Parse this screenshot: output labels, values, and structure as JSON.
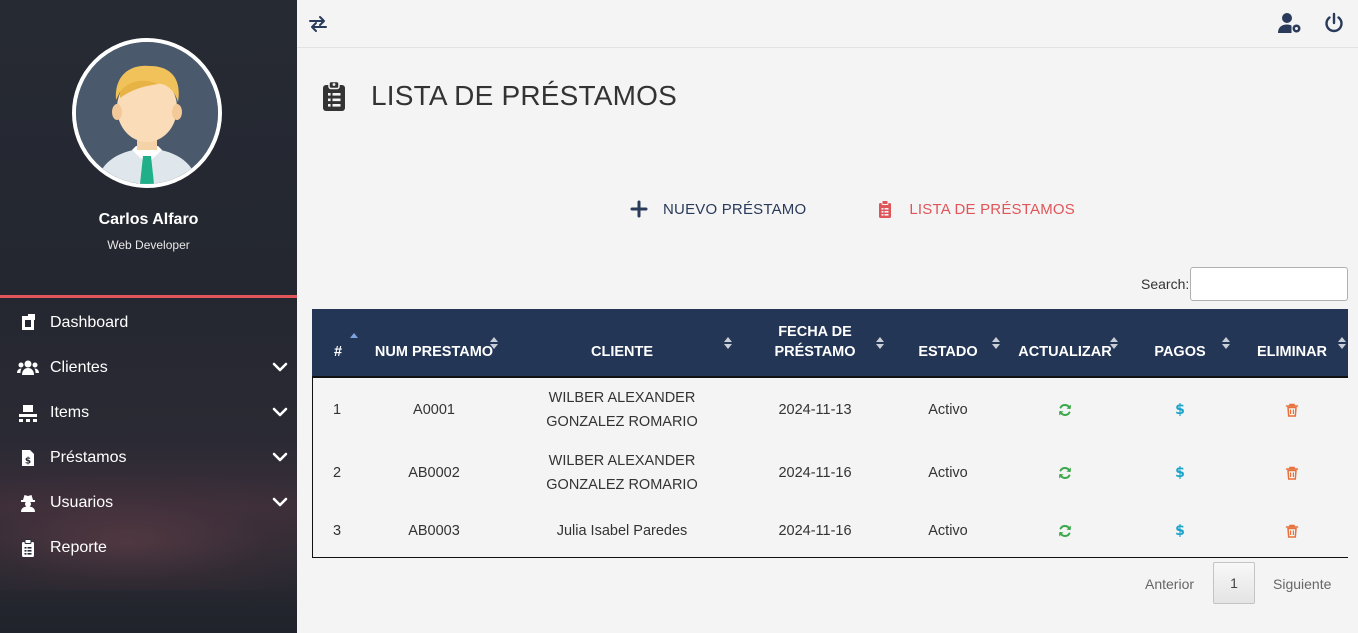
{
  "user": {
    "name": "Carlos Alfaro",
    "role": "Web Developer"
  },
  "sidebar": {
    "items": [
      {
        "label": "Dashboard",
        "icon": "dashboard-icon",
        "expandable": false
      },
      {
        "label": "Clientes",
        "icon": "users-icon",
        "expandable": true
      },
      {
        "label": "Items",
        "icon": "pallet-icon",
        "expandable": true
      },
      {
        "label": "Préstamos",
        "icon": "file-invoice-dollar-icon",
        "expandable": true
      },
      {
        "label": "Usuarios",
        "icon": "user-secret-icon",
        "expandable": true
      },
      {
        "label": "Reporte",
        "icon": "clipboard-list-icon",
        "expandable": false
      }
    ]
  },
  "page": {
    "title": "LISTA DE PRÉSTAMOS"
  },
  "actions": {
    "new_label": "NUEVO PRÉSTAMO",
    "list_label": "LISTA DE PRÉSTAMOS"
  },
  "search": {
    "label": "Search:",
    "value": ""
  },
  "table": {
    "headers": [
      "#",
      "NUM PRESTAMO",
      "CLIENTE",
      "FECHA DE PRÉSTAMO",
      "ESTADO",
      "ACTUALIZAR",
      "PAGOS",
      "ELIMINAR"
    ],
    "rows": [
      {
        "num": "1",
        "code": "A0001",
        "client": "WILBER ALEXANDER GONZALEZ ROMARIO",
        "date": "2024-11-13",
        "status": "Activo"
      },
      {
        "num": "2",
        "code": "AB0002",
        "client": "WILBER ALEXANDER GONZALEZ ROMARIO",
        "date": "2024-11-16",
        "status": "Activo"
      },
      {
        "num": "3",
        "code": "AB0003",
        "client": "Julia Isabel Paredes",
        "date": "2024-11-16",
        "status": "Activo"
      }
    ]
  },
  "pagination": {
    "prev": "Anterior",
    "page": "1",
    "next": "Siguiente"
  },
  "colors": {
    "sidebar_bg": "#262a33",
    "accent_red": "#e0555a",
    "table_header": "#243656",
    "update_green": "#3aa84a",
    "pay_cyan": "#1aa3c8",
    "delete_orange": "#e8703a"
  }
}
